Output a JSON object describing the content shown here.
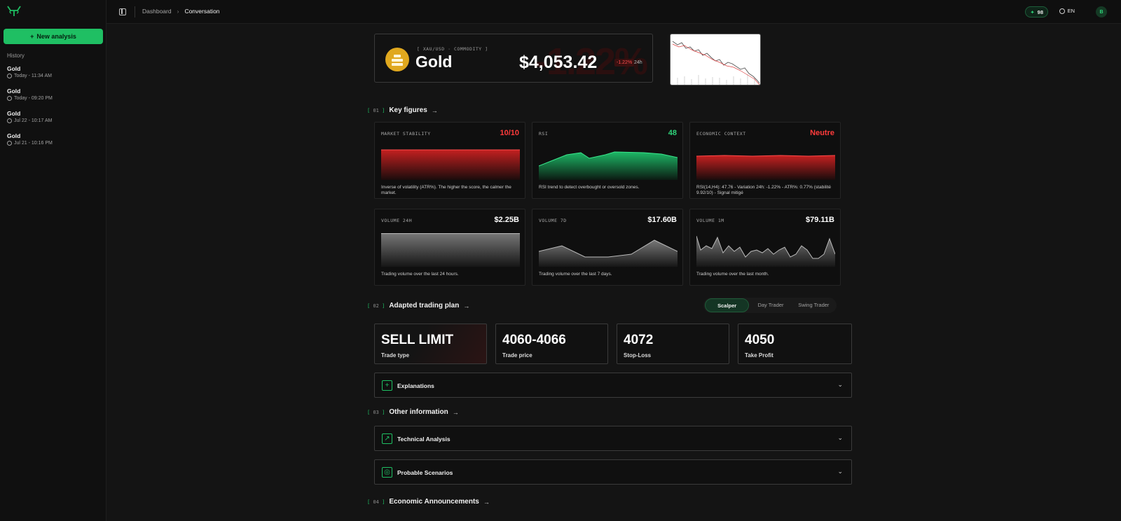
{
  "sidebar": {
    "new_button": "New analysis",
    "history_title": "History",
    "history": [
      {
        "name": "Gold",
        "time": "Today - 11:34 AM"
      },
      {
        "name": "Gold",
        "time": "Today - 09:20 PM"
      },
      {
        "name": "Gold",
        "time": "Jul 22 - 10:17 AM"
      },
      {
        "name": "Gold",
        "time": "Jul 21 - 10:16 PM"
      }
    ]
  },
  "topbar": {
    "breadcrumb": [
      "Dashboard",
      "Conversation"
    ],
    "credits": "98",
    "language": "EN",
    "avatar_initial": "B"
  },
  "asset": {
    "tag": "[ XAU/USD · COMMODITY ]",
    "name": "Gold",
    "price": "$4,053.42",
    "change": "-1.22%",
    "period": "24h",
    "background_text": "-1.22%",
    "logo_color": "#e0a81e"
  },
  "sections": {
    "key_figures": {
      "num": "01",
      "title": "Key figures"
    },
    "trading_plan": {
      "num": "02",
      "title": "Adapted trading plan"
    },
    "other_info": {
      "num": "03",
      "title": "Other information"
    },
    "economic": {
      "num": "04",
      "title": "Economic Announcements"
    }
  },
  "cards": [
    {
      "label": "MARKET STABILITY",
      "value": "10/10",
      "value_color": "#ff3b3b",
      "desc": "Inverse of volatility (ATR%). The higher the score, the calmer the market.",
      "chart": "red"
    },
    {
      "label": "RSI",
      "value": "48",
      "value_color": "#2fd47a",
      "desc": "RSI trend to detect overbought or oversold zones.",
      "chart": "green"
    },
    {
      "label": "ECONOMIC CONTEXT",
      "value": "Neutre",
      "value_color": "#ff3b3b",
      "desc": "RSI(14,H4): 47.76 - Variation 24h: -1.22% - ATR%: 0.77% (stabilité 9.92/10) - Signal mitigé",
      "chart": "red"
    },
    {
      "label": "VOLUME 24H",
      "value": "$2.25B",
      "value_color": "#ffffff",
      "desc": "Trading volume over the last 24 hours.",
      "chart": "gray"
    },
    {
      "label": "VOLUME 7D",
      "value": "$17.60B",
      "value_color": "#ffffff",
      "desc": "Trading volume over the last 7 days.",
      "chart": "gray"
    },
    {
      "label": "VOLUME 1M",
      "value": "$79.11B",
      "value_color": "#ffffff",
      "desc": "Trading volume over the last month.",
      "chart": "gray"
    }
  ],
  "plan": {
    "tabs": [
      "Scalper",
      "Day Trader",
      "Swing Trader"
    ],
    "active_tab": "Scalper",
    "values": [
      {
        "value": "SELL LIMIT",
        "label": "Trade type"
      },
      {
        "value": "4060-4066",
        "label": "Trade price"
      },
      {
        "value": "4072",
        "label": "Stop-Loss"
      },
      {
        "value": "4050",
        "label": "Take Profit"
      }
    ]
  },
  "accordions": {
    "explanations": "Explanations",
    "technical": "Technical Analysis",
    "scenarios": "Probable Scenarios"
  },
  "colors": {
    "accent": "#1fbf63",
    "negative": "#ff3b3b",
    "positive": "#2fd47a"
  }
}
